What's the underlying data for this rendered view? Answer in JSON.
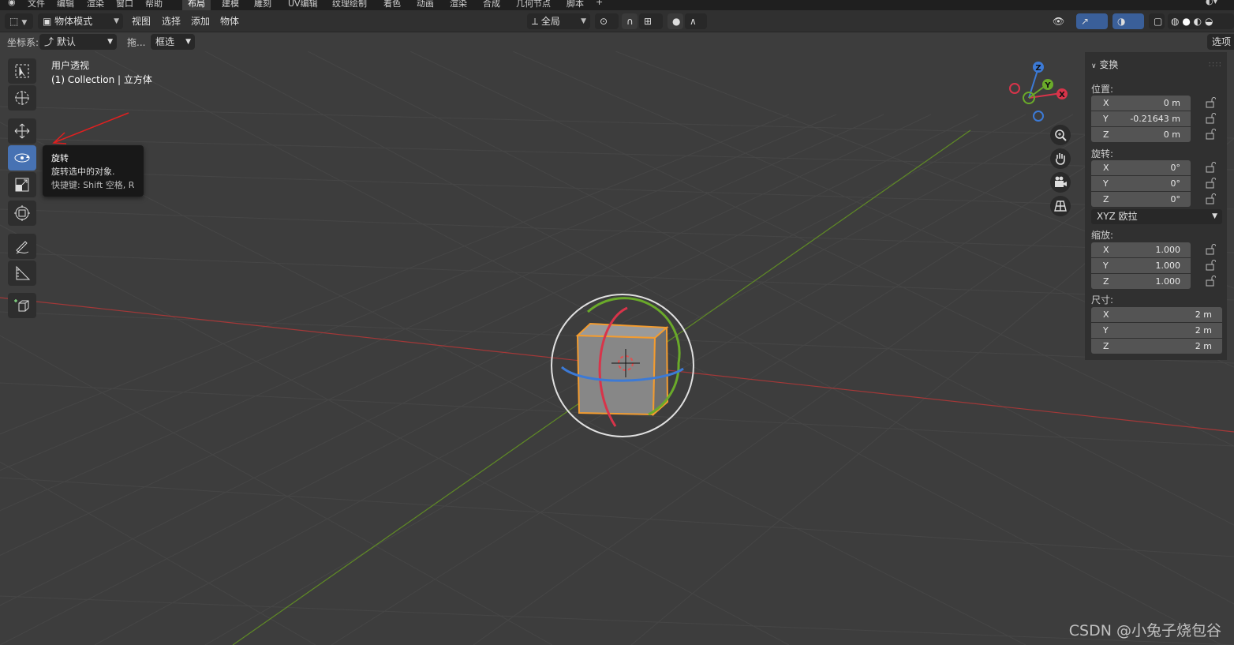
{
  "topbar": {
    "menus": [
      "文件",
      "编辑",
      "渲染",
      "窗口",
      "帮助"
    ],
    "workspaces": [
      "布局",
      "建模",
      "雕刻",
      "UV编辑",
      "纹理绘制",
      "着色",
      "动画",
      "渲染",
      "合成",
      "几何节点",
      "脚本"
    ],
    "active_workspace": "布局",
    "add_tab": "+"
  },
  "header": {
    "mode": "物体模式",
    "menus": [
      "视图",
      "选择",
      "添加",
      "物体"
    ],
    "orientation": "全局"
  },
  "toolsettings": {
    "coord_label": "坐标系:",
    "coord_value": "默认",
    "drag_label": "拖...",
    "select_value": "框选",
    "options_label": "选项"
  },
  "viewport": {
    "title": "用户透视",
    "subtitle": "(1) Collection | 立方体"
  },
  "tooltip": {
    "title": "旋转",
    "description": "旋转选中的对象.",
    "shortcut": "快捷键: Shift 空格, R"
  },
  "gizmo": {
    "x": "X",
    "y": "Y",
    "z": "Z"
  },
  "npanel": {
    "title": "变换",
    "location_label": "位置:",
    "location": [
      {
        "axis": "X",
        "value": "0 m"
      },
      {
        "axis": "Y",
        "value": "-0.21643 m"
      },
      {
        "axis": "Z",
        "value": "0 m"
      }
    ],
    "rotation_label": "旋转:",
    "rotation": [
      {
        "axis": "X",
        "value": "0°"
      },
      {
        "axis": "Y",
        "value": "0°"
      },
      {
        "axis": "Z",
        "value": "0°"
      }
    ],
    "rotation_mode": "XYZ 欧拉",
    "scale_label": "缩放:",
    "scale": [
      {
        "axis": "X",
        "value": "1.000"
      },
      {
        "axis": "Y",
        "value": "1.000"
      },
      {
        "axis": "Z",
        "value": "1.000"
      }
    ],
    "dimensions_label": "尺寸:",
    "dimensions": [
      {
        "axis": "X",
        "value": "2 m"
      },
      {
        "axis": "Y",
        "value": "2 m"
      },
      {
        "axis": "Z",
        "value": "2 m"
      }
    ]
  },
  "watermark": "CSDN @小兔子烧包谷",
  "colors": {
    "accent": "#4772b3",
    "x_axis": "#c23b3b",
    "y_axis": "#6a9b2a",
    "z_axis": "#3c7ad6",
    "selection": "#f39c30"
  }
}
